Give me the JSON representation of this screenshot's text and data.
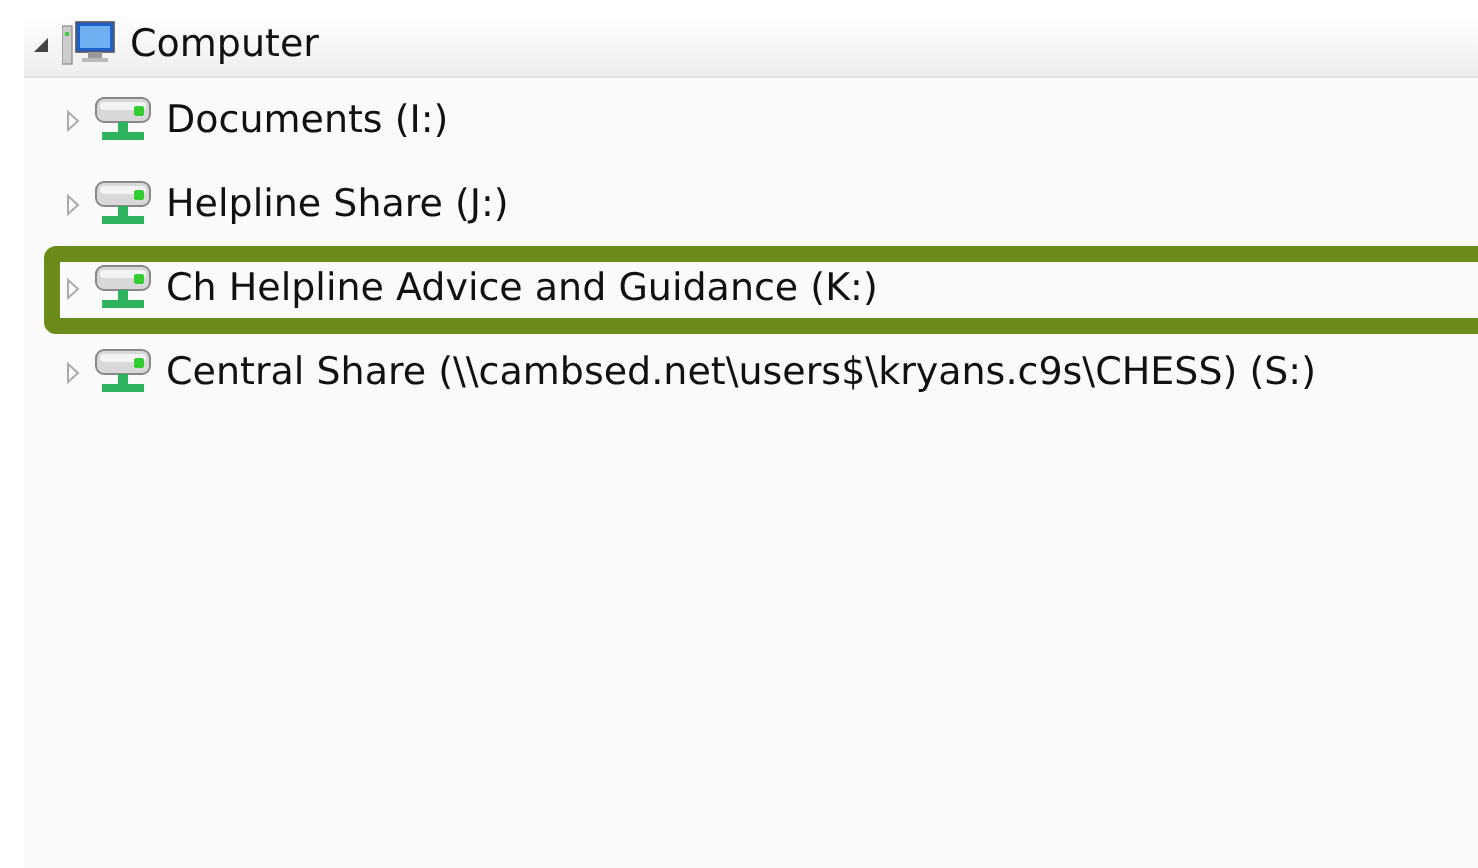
{
  "tree": {
    "label": "Computer",
    "expanded": true,
    "children": [
      {
        "label": "Documents (I:)",
        "expanded": false,
        "highlighted": false
      },
      {
        "label": "Helpline Share (J:)",
        "expanded": false,
        "highlighted": false
      },
      {
        "label": "Ch Helpline Advice and Guidance (K:)",
        "expanded": false,
        "highlighted": true
      },
      {
        "label": "Central Share (\\\\cambsed.net\\users$\\kryans.c9s\\CHESS) (S:)",
        "expanded": false,
        "highlighted": false
      }
    ]
  }
}
